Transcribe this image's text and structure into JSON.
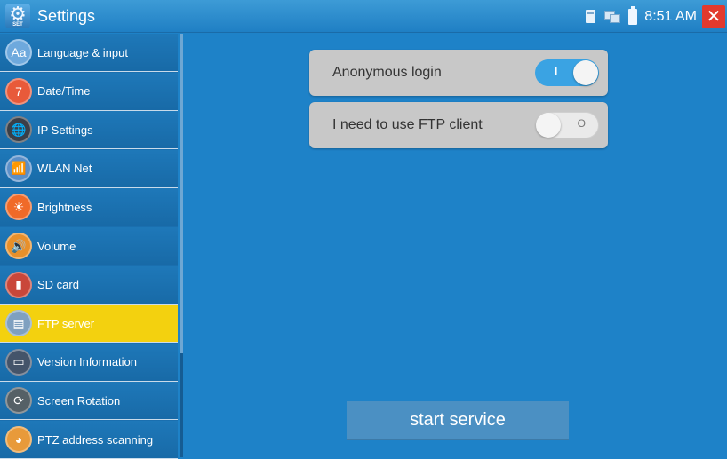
{
  "titlebar": {
    "title": "Settings",
    "app_icon_caption": "SET",
    "time": "8:51 AM"
  },
  "sidebar": {
    "items": [
      {
        "label": "Language & input",
        "icon": "language-icon",
        "glyph": "Aa",
        "color": "#6ea9dd"
      },
      {
        "label": "Date/Time",
        "icon": "calendar-icon",
        "glyph": "7",
        "color": "#e85a3a"
      },
      {
        "label": "IP Settings",
        "icon": "globe-icon",
        "glyph": "🌐",
        "color": "#3a3f48"
      },
      {
        "label": "WLAN Net",
        "icon": "wifi-antenna-icon",
        "glyph": "📶",
        "color": "#5b8fc8"
      },
      {
        "label": "Brightness",
        "icon": "brightness-icon",
        "glyph": "☀",
        "color": "#f06a28"
      },
      {
        "label": "Volume",
        "icon": "volume-icon",
        "glyph": "🔊",
        "color": "#e8902a"
      },
      {
        "label": "SD card",
        "icon": "sd-card-icon",
        "glyph": "▮",
        "color": "#c9473a"
      },
      {
        "label": "FTP server",
        "icon": "ftp-server-icon",
        "glyph": "▤",
        "color": "#7fa0c0"
      },
      {
        "label": "Version Information",
        "icon": "version-info-icon",
        "glyph": "▭",
        "color": "#44546a"
      },
      {
        "label": "Screen Rotation",
        "icon": "screen-rotation-icon",
        "glyph": "⟳",
        "color": "#556066"
      },
      {
        "label": "PTZ address scanning",
        "icon": "ptz-camera-icon",
        "glyph": "◕",
        "color": "#e89a3a"
      }
    ],
    "active_index": 7
  },
  "main": {
    "options": [
      {
        "label": "Anonymous login",
        "state": "on",
        "toggle_mark": "I"
      },
      {
        "label": "I need to use FTP client",
        "state": "off",
        "toggle_mark": "O"
      }
    ],
    "start_button": "start service"
  },
  "colors": {
    "background": "#1e82c8",
    "active_item": "#f3d10f",
    "toggle_on": "#3aa3e3",
    "close": "#e23a2e"
  }
}
